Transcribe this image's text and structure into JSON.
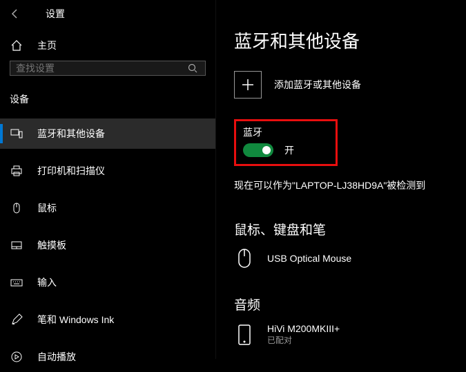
{
  "titlebar": {
    "label": "设置"
  },
  "nav": {
    "home": "主页",
    "search_placeholder": "查找设置",
    "section": "设备",
    "items": [
      {
        "label": "蓝牙和其他设备",
        "icon": "bluetooth-devices-icon"
      },
      {
        "label": "打印机和扫描仪",
        "icon": "printer-icon"
      },
      {
        "label": "鼠标",
        "icon": "mouse-icon"
      },
      {
        "label": "触摸板",
        "icon": "touchpad-icon"
      },
      {
        "label": "输入",
        "icon": "keyboard-icon"
      },
      {
        "label": "笔和 Windows Ink",
        "icon": "pen-icon"
      },
      {
        "label": "自动播放",
        "icon": "autoplay-icon"
      }
    ]
  },
  "page": {
    "title": "蓝牙和其他设备",
    "add_device": "添加蓝牙或其他设备",
    "bt_label": "蓝牙",
    "bt_state": "开",
    "discoverable": "现在可以作为\"LAPTOP-LJ38HD9A\"被检测到",
    "mouse_kb_pen": "鼠标、键盘和笔",
    "mouse_name": "USB Optical Mouse",
    "audio": "音频",
    "audio_name": "HiVi M200MKIII+",
    "audio_status": "已配对"
  }
}
